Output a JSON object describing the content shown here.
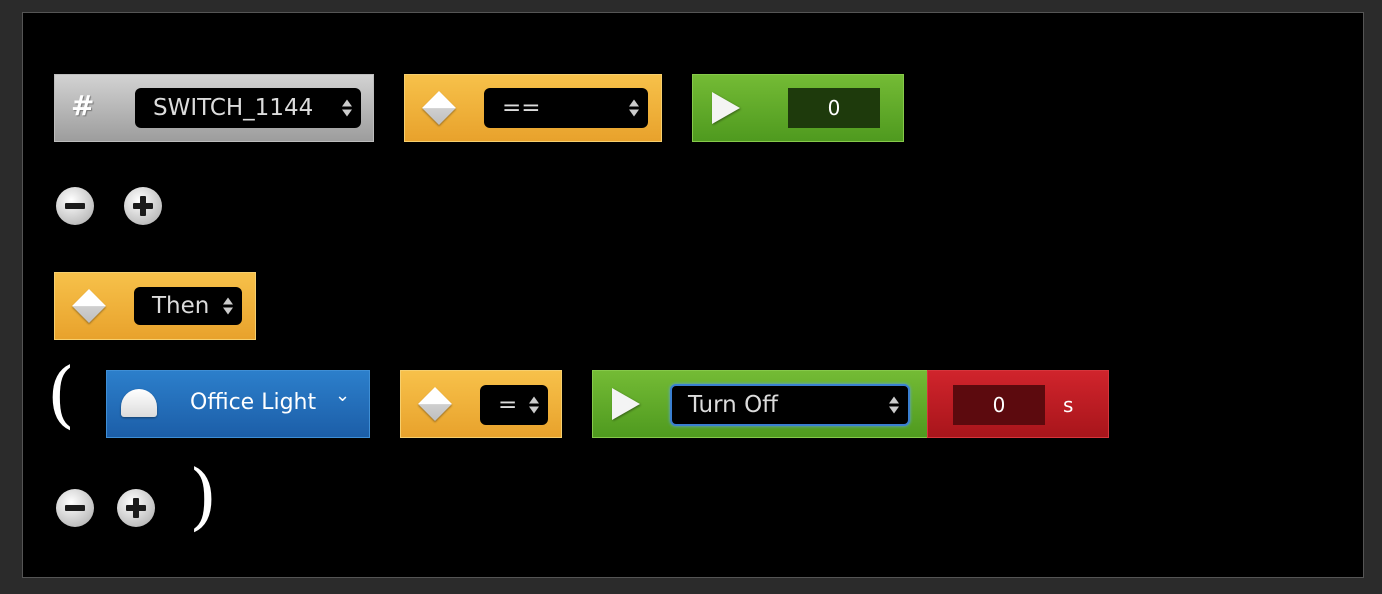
{
  "condition": {
    "variable": {
      "icon": "hash-icon",
      "value": "SWITCH_1144"
    },
    "operator": {
      "icon": "diamond-icon",
      "value": "=="
    },
    "compare_value": {
      "icon": "play-icon",
      "value": "0"
    }
  },
  "then_block": {
    "icon": "diamond-icon",
    "value": "Then"
  },
  "action": {
    "open_paren": "(",
    "close_paren": ")",
    "device": {
      "icon": "bulb-icon",
      "label": "Office Light",
      "chevron": "⌄"
    },
    "assign": {
      "icon": "diamond-icon",
      "value": "="
    },
    "command": {
      "icon": "play-icon",
      "value": "Turn Off"
    },
    "delay": {
      "value": "0",
      "unit": "s"
    }
  },
  "controls": {
    "remove_icon": "minus-circle-icon",
    "add_icon": "plus-circle-icon"
  },
  "colors": {
    "canvas": "#000000",
    "gray_block": "#b5b5b5",
    "orange_block": "#f0b03c",
    "green_block": "#5fa928",
    "blue_block": "#2470bd",
    "red_block": "#bf1c22"
  }
}
